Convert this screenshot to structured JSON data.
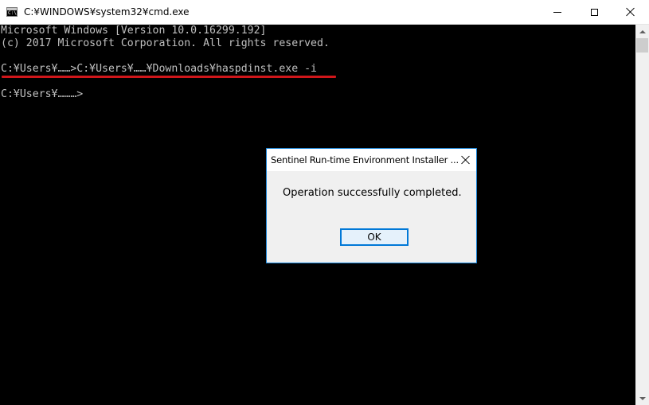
{
  "window": {
    "title": "C:¥WINDOWS¥system32¥cmd.exe"
  },
  "console": {
    "lines": [
      "Microsoft Windows [Version 10.0.16299.192]",
      "(c) 2017 Microsoft Corporation. All rights reserved.",
      "C:¥Users¥……>C:¥Users¥……¥Downloads¥haspdinst.exe -i",
      "C:¥Users¥………>"
    ]
  },
  "dialog": {
    "title": "Sentinel Run-time Environment Installer ...",
    "message": "Operation successfully completed.",
    "ok_label": "OK"
  },
  "colors": {
    "console_bg": "#000000",
    "console_text": "#c0c0c0",
    "annotation_underline": "#d0161a",
    "dialog_border": "#1883d7",
    "button_focus": "#0078d7"
  },
  "icons": {
    "app": "cmd-icon",
    "minimize": "minimize-icon",
    "maximize": "maximize-icon",
    "close": "close-icon"
  }
}
